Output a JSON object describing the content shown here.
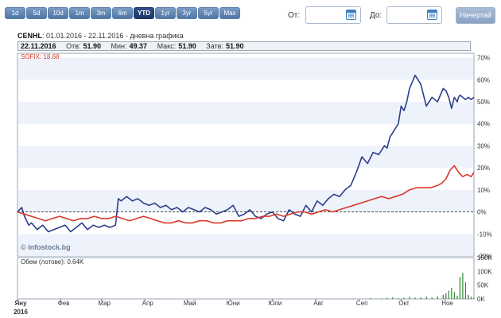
{
  "toolbar": {
    "periods": [
      "1d",
      "5d",
      "10d",
      "1m",
      "3m",
      "6m",
      "YTD",
      "1уг",
      "3уг",
      "5уг",
      "Max"
    ],
    "active_period": "YTD",
    "from_label": "От:",
    "to_label": "До:",
    "from_value": "",
    "to_value": "",
    "draw_label": "Начертай"
  },
  "header": {
    "ticker": "CENHL",
    "range_text": ": 01.01.2016 - 22.11.2016 - дневна графика"
  },
  "info": {
    "date": "22.11.2016",
    "open_label": "Отв:",
    "open": "51.90",
    "min_label": "Мин:",
    "min": "49.37",
    "max_label": "Макс:",
    "max": "51.90",
    "close_label": "Затв:",
    "close": "51.90"
  },
  "benchmark_label": "SOFIX: 18.68",
  "copyright": "© infostock.bg",
  "volume_label": "Обем (лотове): 0.64K",
  "colors": {
    "primary_series": "#2b3f8c",
    "benchmark_series": "#d9382b",
    "volume_bars": "#2e8b2e",
    "stripe": "#eef2fa",
    "zero_line": "#333333"
  },
  "chart_data": {
    "type": "line",
    "x_axis_labels": [
      "Яну",
      "Фев",
      "Мар",
      "Апр",
      "Май",
      "Юни",
      "Юли",
      "Авг",
      "Сеп",
      "Окт",
      "Ное"
    ],
    "x_axis_year": "2016",
    "x_range_days": [
      0,
      326
    ],
    "ylabel": "",
    "y_ticks": [
      "70%",
      "60%",
      "50%",
      "40%",
      "30%",
      "20%",
      "10%",
      "0%",
      "-10%",
      "-20%"
    ],
    "ylim": [
      -20,
      72
    ],
    "zero_line": "dashed",
    "series": [
      {
        "name": "CENHL",
        "x": [
          0,
          3,
          5,
          8,
          10,
          14,
          18,
          22,
          26,
          30,
          34,
          38,
          42,
          46,
          50,
          54,
          58,
          62,
          66,
          70,
          72,
          74,
          76,
          78,
          82,
          86,
          90,
          94,
          98,
          102,
          106,
          110,
          114,
          118,
          122,
          126,
          130,
          134,
          138,
          142,
          146,
          150,
          154,
          158,
          162,
          166,
          170,
          174,
          178,
          182,
          186,
          190,
          194,
          198,
          202,
          206,
          210,
          214,
          218,
          222,
          226,
          230,
          234,
          238,
          242,
          246,
          250,
          254,
          258,
          262,
          264,
          266,
          268,
          270,
          272,
          274,
          276,
          278,
          280,
          284,
          288,
          292,
          296,
          300,
          304,
          306,
          308,
          310,
          312,
          313,
          314,
          315,
          316,
          318,
          320,
          322,
          324,
          326
        ],
        "values": [
          0,
          2,
          -2,
          -6,
          -5,
          -8,
          -6,
          -9,
          -8,
          -7,
          -6,
          -9,
          -7,
          -5,
          -8,
          -6,
          -7,
          -6,
          -7,
          -6,
          6,
          5,
          6,
          7,
          5,
          6,
          4,
          3,
          4,
          2,
          3,
          1,
          2,
          0,
          2,
          1,
          0,
          2,
          1,
          -1,
          0,
          1,
          3,
          -2,
          -1,
          1,
          -2,
          -3,
          -1,
          0,
          -3,
          -4,
          1,
          -1,
          -2,
          3,
          0,
          5,
          3,
          6,
          8,
          7,
          10,
          12,
          18,
          25,
          22,
          27,
          26,
          30,
          29,
          34,
          36,
          38,
          40,
          48,
          46,
          50,
          56,
          62,
          58,
          48,
          52,
          50,
          56,
          55,
          52,
          47,
          52,
          51,
          50,
          52,
          53,
          52,
          51,
          52,
          51,
          52
        ]
      },
      {
        "name": "SOFIX",
        "x": [
          0,
          5,
          10,
          15,
          20,
          25,
          30,
          35,
          40,
          45,
          50,
          55,
          60,
          65,
          70,
          75,
          80,
          85,
          90,
          95,
          100,
          105,
          110,
          115,
          120,
          125,
          130,
          135,
          140,
          145,
          150,
          155,
          160,
          165,
          170,
          175,
          180,
          185,
          190,
          195,
          200,
          205,
          210,
          215,
          220,
          225,
          230,
          235,
          240,
          245,
          250,
          255,
          260,
          265,
          270,
          275,
          280,
          285,
          290,
          295,
          300,
          303,
          306,
          309,
          312,
          315,
          318,
          321,
          324,
          326
        ],
        "values": [
          0,
          -1,
          -2,
          -3,
          -4,
          -3,
          -2,
          -3,
          -4,
          -3,
          -3,
          -2,
          -3,
          -3,
          -2,
          -3,
          -4,
          -3,
          -2,
          -3,
          -4,
          -5,
          -5,
          -4,
          -5,
          -5,
          -4,
          -4,
          -5,
          -5,
          -4,
          -4,
          -4,
          -3,
          -3,
          -2,
          -2,
          -1,
          -2,
          -1,
          0,
          0,
          -1,
          0,
          1,
          0,
          1,
          2,
          3,
          4,
          5,
          6,
          7,
          6,
          7,
          8,
          10,
          11,
          11,
          11,
          12,
          13,
          15,
          19,
          21,
          18,
          16,
          17,
          16,
          18
        ]
      }
    ],
    "volume": {
      "y_ticks": [
        "150K",
        "100K",
        "50K",
        "0K"
      ],
      "ylim": [
        0,
        150
      ],
      "x": [
        240,
        252,
        260,
        264,
        268,
        272,
        276,
        280,
        284,
        288,
        292,
        296,
        300,
        304,
        306,
        308,
        310,
        312,
        314,
        316,
        318,
        320,
        322,
        324,
        326
      ],
      "values": [
        2,
        3,
        2,
        4,
        6,
        3,
        5,
        8,
        5,
        6,
        9,
        6,
        10,
        15,
        20,
        30,
        40,
        25,
        12,
        80,
        95,
        60,
        15,
        8,
        5
      ]
    }
  }
}
